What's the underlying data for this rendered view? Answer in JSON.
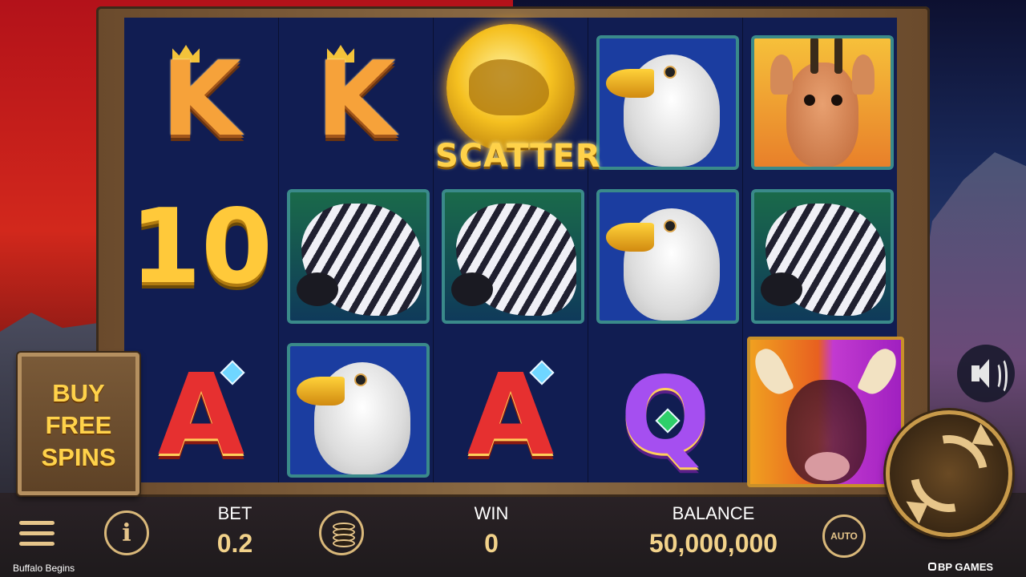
{
  "game": {
    "title": "Buffalo Begins",
    "brand": "BP GAMES"
  },
  "reels": {
    "rows": [
      [
        "K",
        "K",
        "SCATTER",
        "eagle",
        "antelope"
      ],
      [
        "10",
        "zebra",
        "zebra",
        "eagle",
        "zebra"
      ],
      [
        "A",
        "eagle",
        "A",
        "Q",
        "buffalo"
      ]
    ],
    "scatter_label": "SCATTER",
    "letters": {
      "k": "K",
      "ten": "10",
      "a": "A",
      "q": "Q"
    }
  },
  "buy_button": {
    "line1": "BUY",
    "line2": "FREE",
    "line3": "SPINS"
  },
  "bottom_bar": {
    "bet_label": "BET",
    "bet_value": "0.2",
    "win_label": "WIN",
    "win_value": "0",
    "balance_label": "BALANCE",
    "balance_value": "50,000,000",
    "info_glyph": "i",
    "auto_label": "AUTO"
  },
  "icons": [
    "menu-icon",
    "info-icon",
    "coin-stack-icon",
    "autoplay-icon",
    "spin-icon",
    "sound-icon"
  ]
}
